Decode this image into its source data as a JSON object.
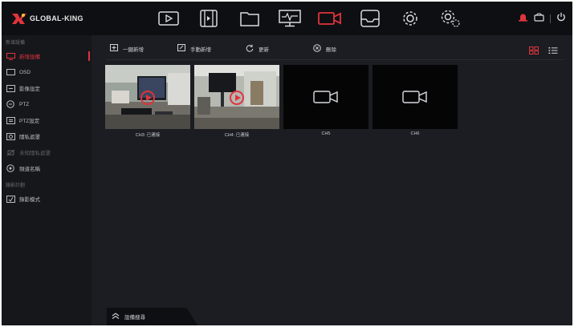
{
  "brand": {
    "name": "GLOBAL-KING",
    "accent": "#e0343c"
  },
  "topnav": {
    "items": [
      {
        "name": "playback",
        "icon": "play-icon"
      },
      {
        "name": "video",
        "icon": "film-icon"
      },
      {
        "name": "files",
        "icon": "folder-icon"
      },
      {
        "name": "monitor",
        "icon": "monitor-icon"
      },
      {
        "name": "camera",
        "icon": "camera-icon",
        "active": true
      },
      {
        "name": "storage",
        "icon": "tray-icon"
      },
      {
        "name": "settings",
        "icon": "gear-icon"
      },
      {
        "name": "system",
        "icon": "gears-icon"
      }
    ]
  },
  "sidebar": {
    "section1": "新增設備",
    "items": [
      {
        "label": "新增設備",
        "icon": "add-device-icon",
        "active": true
      },
      {
        "label": "OSD",
        "icon": "osd-icon"
      },
      {
        "label": "影像設定",
        "icon": "image-settings-icon"
      },
      {
        "label": "PTZ",
        "icon": "ptz-icon"
      },
      {
        "label": "PTZ設定",
        "icon": "ptz-settings-icon"
      },
      {
        "label": "隱私遮罩",
        "icon": "privacy-mask-icon"
      },
      {
        "label": "未知隱私遮罩",
        "icon": "unknown-mask-icon",
        "disabled": true
      },
      {
        "label": "頻道名稱",
        "icon": "channel-name-icon"
      }
    ],
    "section2": "錄影計劃",
    "items2": [
      {
        "label": "錄影模式",
        "icon": "record-mode-icon"
      }
    ]
  },
  "toolbar": {
    "add_one": "一鍵新增",
    "add_manual": "手動新增",
    "refresh": "更新",
    "delete": "刪除"
  },
  "cameras": [
    {
      "label": "CH3: 已連接",
      "connected": true
    },
    {
      "label": "CH4: 已連接",
      "connected": true
    },
    {
      "label": "CH5",
      "connected": false
    },
    {
      "label": "CH6",
      "connected": false
    }
  ],
  "bottom": {
    "label": "設備搜尋"
  }
}
